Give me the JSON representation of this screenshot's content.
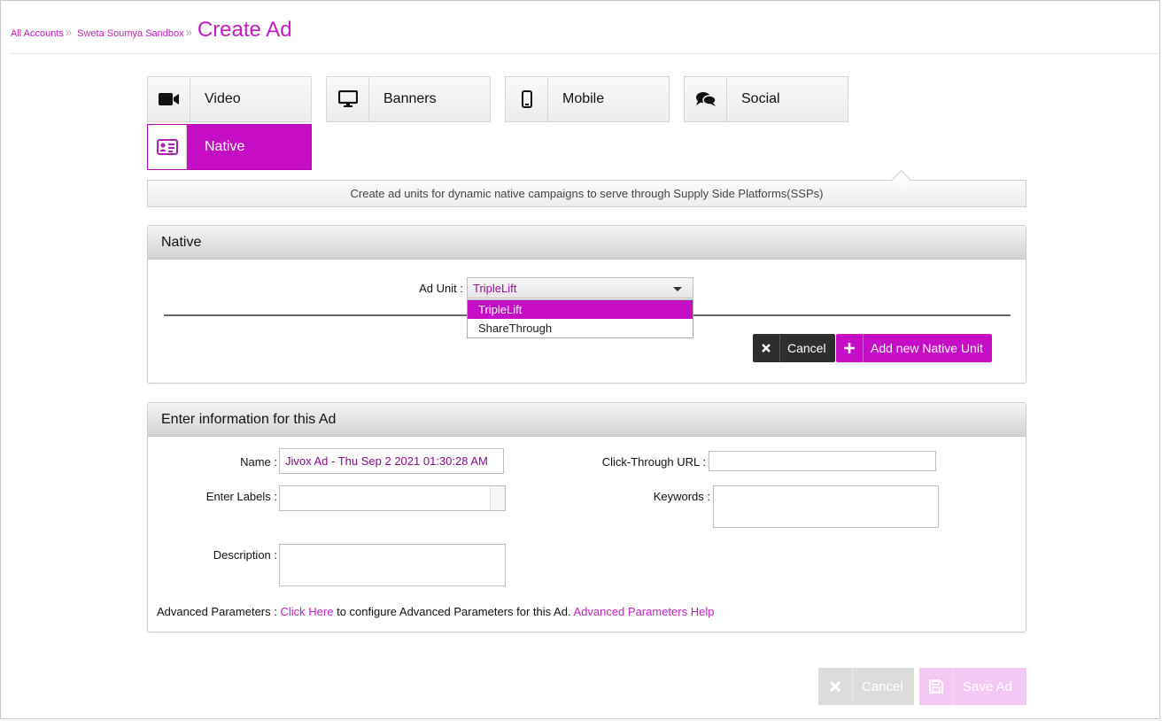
{
  "breadcrumb": {
    "items": [
      "All Accounts",
      "Sweta Soumya Sandbox"
    ],
    "current": "Create Ad"
  },
  "ad_types": [
    {
      "label": "Video",
      "icon": "video-camera-icon"
    },
    {
      "label": "Banners",
      "icon": "monitor-icon"
    },
    {
      "label": "Mobile",
      "icon": "mobile-phone-icon"
    },
    {
      "label": "Social",
      "icon": "chat-bubbles-icon"
    },
    {
      "label": "Native",
      "icon": "id-card-icon",
      "active": true
    }
  ],
  "description": "Create ad units for dynamic native campaigns to serve through Supply Side Platforms(SSPs)",
  "native_panel": {
    "title": "Native",
    "ad_unit_label": "Ad Unit :",
    "ad_unit_value": "TripleLift",
    "ad_unit_options": [
      "TripleLift",
      "ShareThrough"
    ],
    "cancel_label": "Cancel",
    "add_label": "Add new Native Unit"
  },
  "info_panel": {
    "title": "Enter information for this Ad",
    "name_label": "Name :",
    "name_value": "Jivox Ad - Thu Sep 2 2021 01:30:28 AM",
    "labels_label": "Enter Labels :",
    "description_label": "Description :",
    "click_through_label": "Click-Through URL :",
    "keywords_label": "Keywords :",
    "advanced": {
      "prefix": "Advanced Parameters :",
      "link": "Click Here",
      "middle": "to configure Advanced Parameters for this Ad.",
      "help": "Advanced Parameters Help"
    }
  },
  "footer": {
    "cancel_label": "Cancel",
    "save_label": "Save Ad"
  },
  "colors": {
    "accent": "#c40dc4",
    "link": "#c21ec2"
  }
}
